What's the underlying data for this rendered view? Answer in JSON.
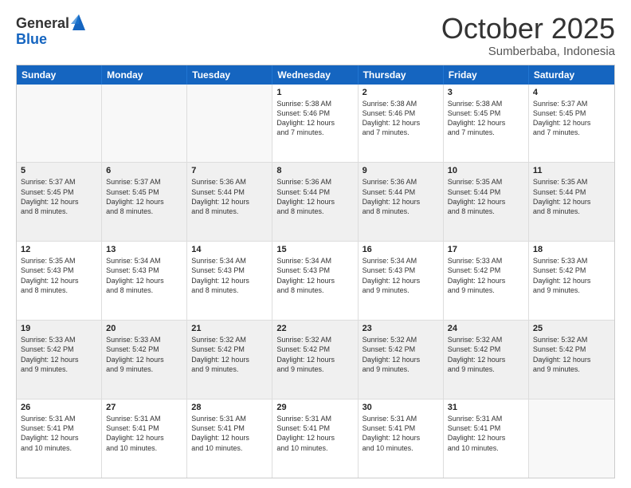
{
  "logo": {
    "general": "General",
    "blue": "Blue"
  },
  "title": "October 2025",
  "subtitle": "Sumberbaba, Indonesia",
  "days": [
    "Sunday",
    "Monday",
    "Tuesday",
    "Wednesday",
    "Thursday",
    "Friday",
    "Saturday"
  ],
  "weeks": [
    [
      {
        "day": "",
        "lines": []
      },
      {
        "day": "",
        "lines": []
      },
      {
        "day": "",
        "lines": []
      },
      {
        "day": "1",
        "lines": [
          "Sunrise: 5:38 AM",
          "Sunset: 5:46 PM",
          "Daylight: 12 hours",
          "and 7 minutes."
        ]
      },
      {
        "day": "2",
        "lines": [
          "Sunrise: 5:38 AM",
          "Sunset: 5:46 PM",
          "Daylight: 12 hours",
          "and 7 minutes."
        ]
      },
      {
        "day": "3",
        "lines": [
          "Sunrise: 5:38 AM",
          "Sunset: 5:45 PM",
          "Daylight: 12 hours",
          "and 7 minutes."
        ]
      },
      {
        "day": "4",
        "lines": [
          "Sunrise: 5:37 AM",
          "Sunset: 5:45 PM",
          "Daylight: 12 hours",
          "and 7 minutes."
        ]
      }
    ],
    [
      {
        "day": "5",
        "lines": [
          "Sunrise: 5:37 AM",
          "Sunset: 5:45 PM",
          "Daylight: 12 hours",
          "and 8 minutes."
        ]
      },
      {
        "day": "6",
        "lines": [
          "Sunrise: 5:37 AM",
          "Sunset: 5:45 PM",
          "Daylight: 12 hours",
          "and 8 minutes."
        ]
      },
      {
        "day": "7",
        "lines": [
          "Sunrise: 5:36 AM",
          "Sunset: 5:44 PM",
          "Daylight: 12 hours",
          "and 8 minutes."
        ]
      },
      {
        "day": "8",
        "lines": [
          "Sunrise: 5:36 AM",
          "Sunset: 5:44 PM",
          "Daylight: 12 hours",
          "and 8 minutes."
        ]
      },
      {
        "day": "9",
        "lines": [
          "Sunrise: 5:36 AM",
          "Sunset: 5:44 PM",
          "Daylight: 12 hours",
          "and 8 minutes."
        ]
      },
      {
        "day": "10",
        "lines": [
          "Sunrise: 5:35 AM",
          "Sunset: 5:44 PM",
          "Daylight: 12 hours",
          "and 8 minutes."
        ]
      },
      {
        "day": "11",
        "lines": [
          "Sunrise: 5:35 AM",
          "Sunset: 5:44 PM",
          "Daylight: 12 hours",
          "and 8 minutes."
        ]
      }
    ],
    [
      {
        "day": "12",
        "lines": [
          "Sunrise: 5:35 AM",
          "Sunset: 5:43 PM",
          "Daylight: 12 hours",
          "and 8 minutes."
        ]
      },
      {
        "day": "13",
        "lines": [
          "Sunrise: 5:34 AM",
          "Sunset: 5:43 PM",
          "Daylight: 12 hours",
          "and 8 minutes."
        ]
      },
      {
        "day": "14",
        "lines": [
          "Sunrise: 5:34 AM",
          "Sunset: 5:43 PM",
          "Daylight: 12 hours",
          "and 8 minutes."
        ]
      },
      {
        "day": "15",
        "lines": [
          "Sunrise: 5:34 AM",
          "Sunset: 5:43 PM",
          "Daylight: 12 hours",
          "and 8 minutes."
        ]
      },
      {
        "day": "16",
        "lines": [
          "Sunrise: 5:34 AM",
          "Sunset: 5:43 PM",
          "Daylight: 12 hours",
          "and 9 minutes."
        ]
      },
      {
        "day": "17",
        "lines": [
          "Sunrise: 5:33 AM",
          "Sunset: 5:42 PM",
          "Daylight: 12 hours",
          "and 9 minutes."
        ]
      },
      {
        "day": "18",
        "lines": [
          "Sunrise: 5:33 AM",
          "Sunset: 5:42 PM",
          "Daylight: 12 hours",
          "and 9 minutes."
        ]
      }
    ],
    [
      {
        "day": "19",
        "lines": [
          "Sunrise: 5:33 AM",
          "Sunset: 5:42 PM",
          "Daylight: 12 hours",
          "and 9 minutes."
        ]
      },
      {
        "day": "20",
        "lines": [
          "Sunrise: 5:33 AM",
          "Sunset: 5:42 PM",
          "Daylight: 12 hours",
          "and 9 minutes."
        ]
      },
      {
        "day": "21",
        "lines": [
          "Sunrise: 5:32 AM",
          "Sunset: 5:42 PM",
          "Daylight: 12 hours",
          "and 9 minutes."
        ]
      },
      {
        "day": "22",
        "lines": [
          "Sunrise: 5:32 AM",
          "Sunset: 5:42 PM",
          "Daylight: 12 hours",
          "and 9 minutes."
        ]
      },
      {
        "day": "23",
        "lines": [
          "Sunrise: 5:32 AM",
          "Sunset: 5:42 PM",
          "Daylight: 12 hours",
          "and 9 minutes."
        ]
      },
      {
        "day": "24",
        "lines": [
          "Sunrise: 5:32 AM",
          "Sunset: 5:42 PM",
          "Daylight: 12 hours",
          "and 9 minutes."
        ]
      },
      {
        "day": "25",
        "lines": [
          "Sunrise: 5:32 AM",
          "Sunset: 5:42 PM",
          "Daylight: 12 hours",
          "and 9 minutes."
        ]
      }
    ],
    [
      {
        "day": "26",
        "lines": [
          "Sunrise: 5:31 AM",
          "Sunset: 5:41 PM",
          "Daylight: 12 hours",
          "and 10 minutes."
        ]
      },
      {
        "day": "27",
        "lines": [
          "Sunrise: 5:31 AM",
          "Sunset: 5:41 PM",
          "Daylight: 12 hours",
          "and 10 minutes."
        ]
      },
      {
        "day": "28",
        "lines": [
          "Sunrise: 5:31 AM",
          "Sunset: 5:41 PM",
          "Daylight: 12 hours",
          "and 10 minutes."
        ]
      },
      {
        "day": "29",
        "lines": [
          "Sunrise: 5:31 AM",
          "Sunset: 5:41 PM",
          "Daylight: 12 hours",
          "and 10 minutes."
        ]
      },
      {
        "day": "30",
        "lines": [
          "Sunrise: 5:31 AM",
          "Sunset: 5:41 PM",
          "Daylight: 12 hours",
          "and 10 minutes."
        ]
      },
      {
        "day": "31",
        "lines": [
          "Sunrise: 5:31 AM",
          "Sunset: 5:41 PM",
          "Daylight: 12 hours",
          "and 10 minutes."
        ]
      },
      {
        "day": "",
        "lines": []
      }
    ]
  ]
}
